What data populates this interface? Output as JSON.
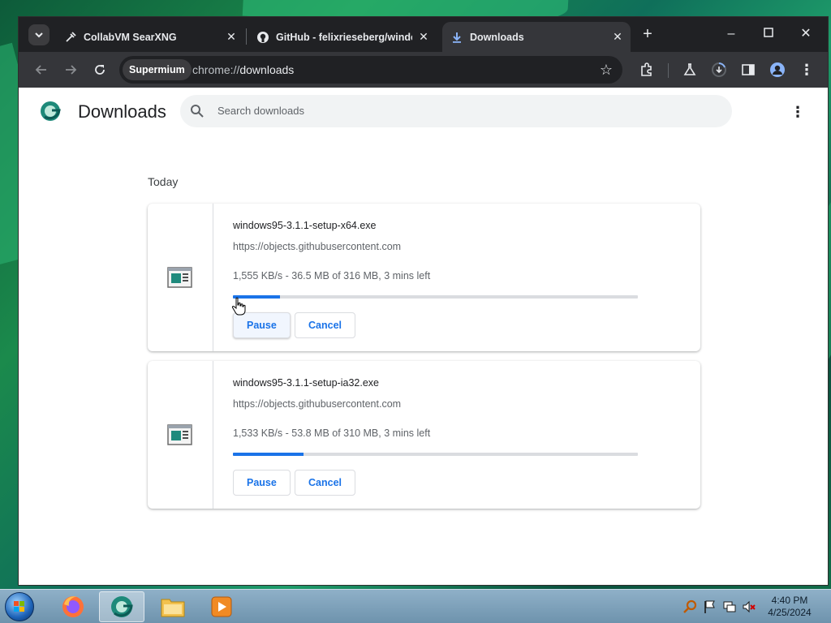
{
  "tabs": [
    {
      "label": "CollabVM SearXNG",
      "icon": "searxng-icon",
      "active": false
    },
    {
      "label": "GitHub - felixrieseberg/windo",
      "icon": "github-icon",
      "active": false
    },
    {
      "label": "Downloads",
      "icon": "download-icon",
      "active": true
    }
  ],
  "omnibox": {
    "chip": "Supermium",
    "url_scheme": "chrome://",
    "url_path": "downloads"
  },
  "page": {
    "title": "Downloads",
    "search_placeholder": "Search downloads",
    "section_date": "Today"
  },
  "downloads": [
    {
      "filename": "windows95-3.1.1-setup-x64.exe",
      "source": "https://objects.githubusercontent.com",
      "status": "1,555 KB/s - 36.5 MB of 316 MB, 3 mins left",
      "progress": 0.116,
      "pause_label": "Pause",
      "cancel_label": "Cancel"
    },
    {
      "filename": "windows95-3.1.1-setup-ia32.exe",
      "source": "https://objects.githubusercontent.com",
      "status": "1,533 KB/s - 53.8 MB of 310 MB, 3 mins left",
      "progress": 0.174,
      "pause_label": "Pause",
      "cancel_label": "Cancel"
    }
  ],
  "clock": {
    "time": "4:40 PM",
    "date": "4/25/2024"
  },
  "colors": {
    "accent": "#1a73e8",
    "chrome_dark": "#202124",
    "toolbar": "#35363a"
  }
}
